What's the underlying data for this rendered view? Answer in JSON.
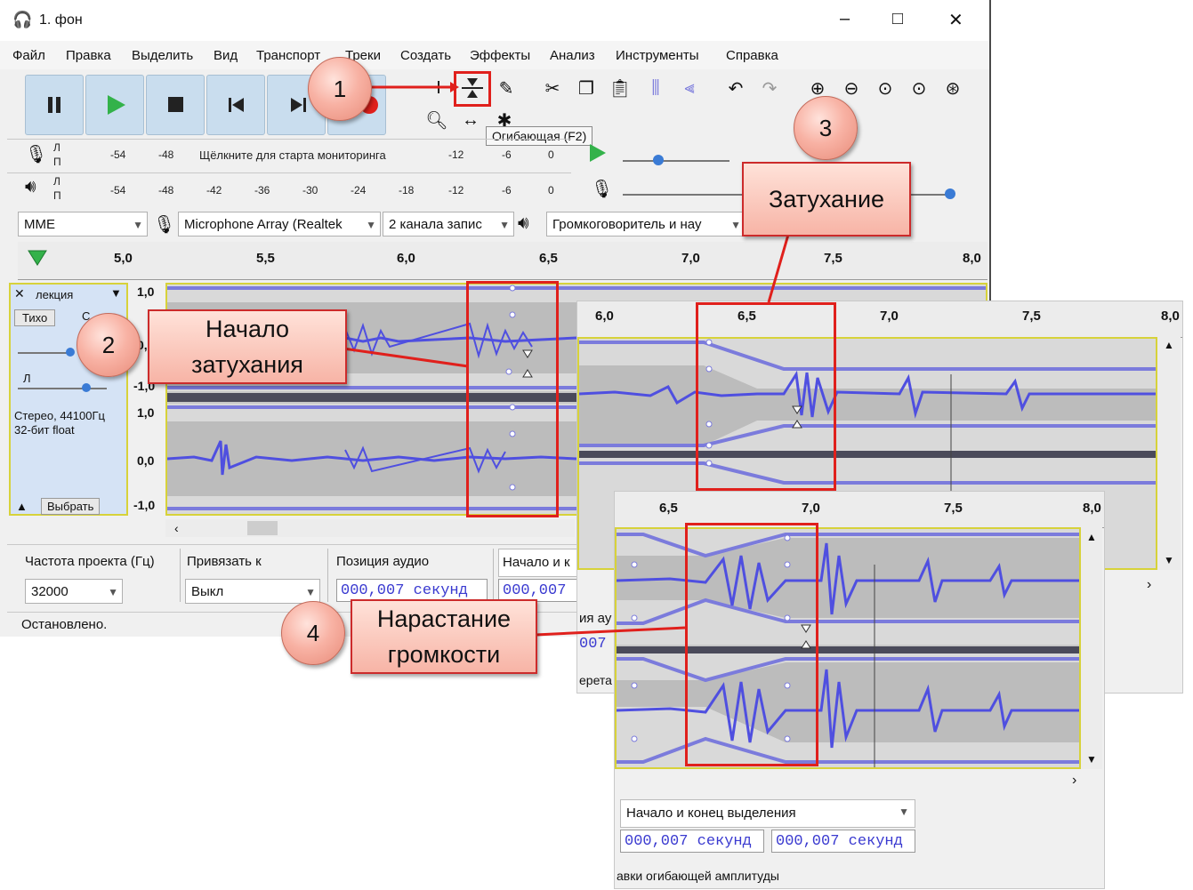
{
  "window": {
    "title": "1. фон",
    "controls": {
      "minimize": "–",
      "maximize": "□",
      "close": "✕"
    }
  },
  "menu": [
    "Файл",
    "Правка",
    "Выделить",
    "Вид",
    "Транспорт",
    "Треки",
    "Создать",
    "Эффекты",
    "Анализ",
    "Инструменты",
    "Справка"
  ],
  "tooltip": "Огибающая (F2)",
  "meters": {
    "record": {
      "ch_l": "Л",
      "ch_r": "П",
      "ticks": [
        "-54",
        "-48"
      ],
      "monitor_text": "Щёлкните для старта мониторинга",
      "ticks_right": [
        "-12",
        "-6",
        "0"
      ]
    },
    "play": {
      "ch_l": "Л",
      "ch_r": "П",
      "ticks": [
        "-54",
        "-48",
        "-42",
        "-36",
        "-30",
        "-24",
        "-18",
        "-12",
        "-6",
        "0"
      ]
    }
  },
  "devices": {
    "host": "MME",
    "mic": "Microphone Array (Realtek",
    "channels": "2 канала запис",
    "speaker": "Громкоговоритель и нау"
  },
  "ruler_main": [
    "5,0",
    "5,5",
    "6,0",
    "6,5",
    "7,0",
    "7,5",
    "8,0"
  ],
  "ruler_zoom1": [
    "6,0",
    "6,5",
    "7,0",
    "7,5",
    "8,0"
  ],
  "ruler_zoom2": [
    "6,5",
    "7,0",
    "7,5",
    "8,0"
  ],
  "track": {
    "close": "✕",
    "name": "лекция",
    "mute": "Тихо",
    "solo": "С",
    "pan_label": "Л",
    "info_line1": "Стерео, 44100Гц",
    "info_line2": "32-бит float",
    "select_button": "Выбрать",
    "scale": [
      "1,0",
      "0,0",
      "-1,0",
      "1,0",
      "0,0",
      "-1,0"
    ]
  },
  "bottom": {
    "rate_label": "Частота проекта (Гц)",
    "rate_value": "32000",
    "snap_label": "Привязать к",
    "snap_value": "Выкл",
    "pos_label": "Позиция аудио",
    "pos_value": "000,007 секунд",
    "sel_label_partial": "Начало и к",
    "sel_value_partial": "000,007",
    "status": "Остановлено."
  },
  "zoom1_bottom": {
    "partial1": "ия ау",
    "partial2": "007",
    "partial3": "ерета"
  },
  "zoom2_bottom": {
    "sel_label": "Начало и конец выделения",
    "start_value": "000,007 секунд",
    "end_value": "000,007 секунд",
    "status_partial": "авки огибающей амплитуды"
  },
  "callouts": {
    "n1": "1",
    "n2": "2",
    "n3": "3",
    "n4": "4",
    "label2_line1": "Начало",
    "label2_line2": "затухания",
    "label3": "Затухание",
    "label4_line1": "Нарастание",
    "label4_line2": "громкости"
  },
  "colors": {
    "waveform": "#4f4fe0",
    "envelope": "#7b7bdc",
    "callout_border": "#e0201c",
    "toolbar_button": "#c9ddee"
  }
}
